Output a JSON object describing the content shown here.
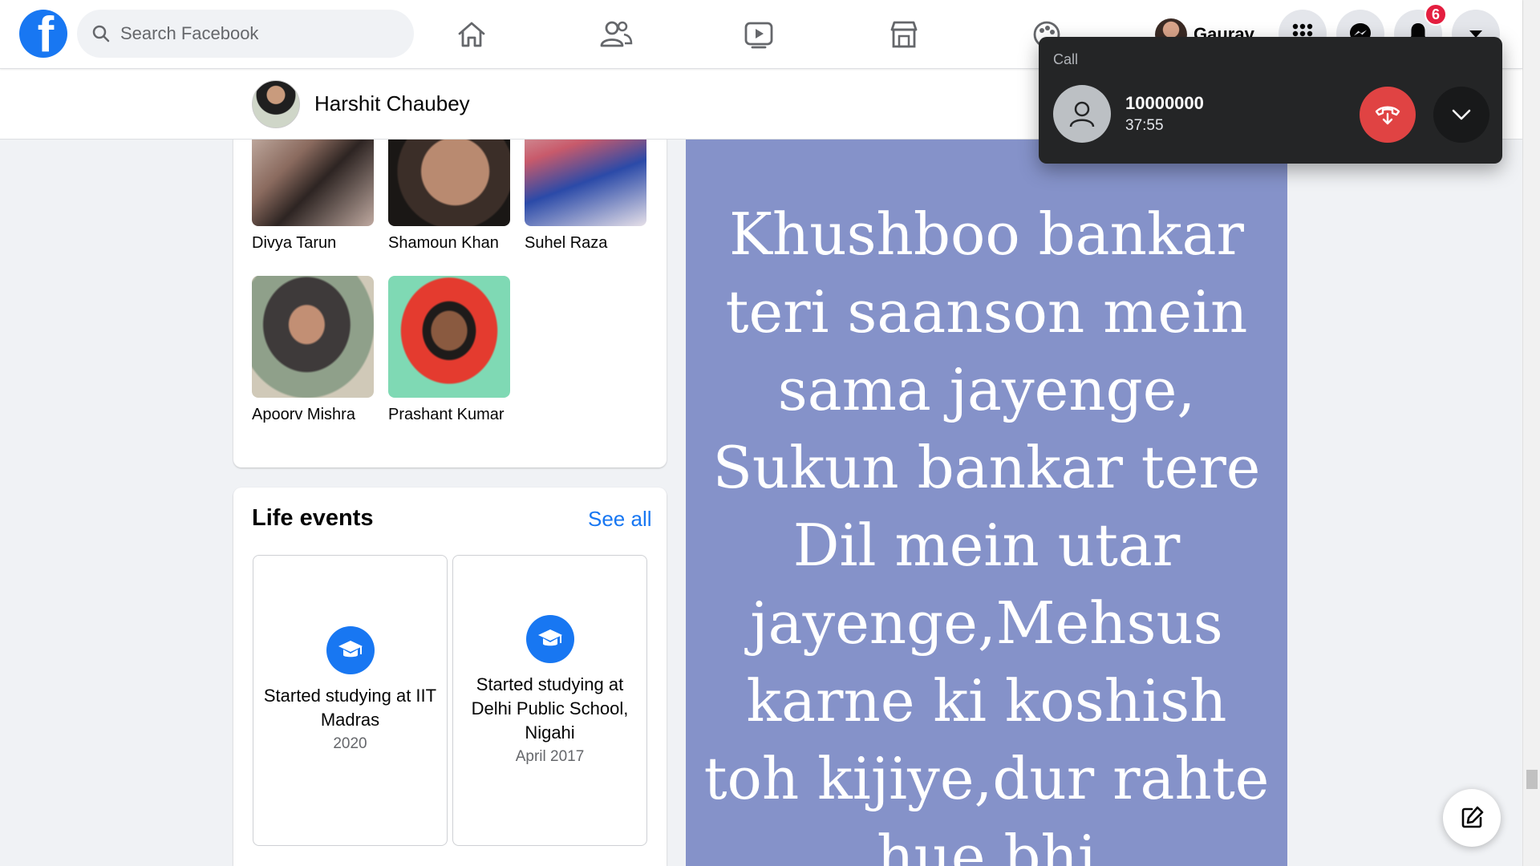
{
  "search": {
    "placeholder": "Search Facebook"
  },
  "nav": {
    "profile_name": "Gaurav",
    "notification_count": "6"
  },
  "profile": {
    "name": "Harshit Chaubey"
  },
  "friends": [
    {
      "name": "Divya Tarun"
    },
    {
      "name": "Shamoun Khan"
    },
    {
      "name": "Suhel Raza"
    },
    {
      "name": "Apoorv Mishra"
    },
    {
      "name": "Prashant Kumar"
    }
  ],
  "life_events": {
    "title": "Life events",
    "see_all": "See all",
    "items": [
      {
        "title": "Started studying at IIT Madras",
        "date": "2020"
      },
      {
        "title": "Started studying at Delhi Public School, Nigahi",
        "date": "April 2017"
      }
    ]
  },
  "post": {
    "text": "Khushboo bankar teri saanson mein sama jayenge, Sukun bankar tere Dil mein utar jayenge,Mehsus karne ki koshish toh kijiye,dur rahte hue bhi",
    "background_color": "#8592c9"
  },
  "call": {
    "label": "Call",
    "number": "10000000",
    "duration": "37:55",
    "end_color": "#e04343"
  },
  "colors": {
    "brand": "#1877f2",
    "badge": "#e41e3f"
  },
  "icons": [
    "facebook-logo-icon",
    "search-icon",
    "home-icon",
    "friends-icon",
    "watch-icon",
    "marketplace-icon",
    "gaming-icon",
    "menu-grid-icon",
    "messenger-icon",
    "bell-icon",
    "caret-down-icon",
    "graduation-cap-icon",
    "person-placeholder-icon",
    "end-call-icon",
    "chevron-down-icon",
    "compose-icon"
  ]
}
